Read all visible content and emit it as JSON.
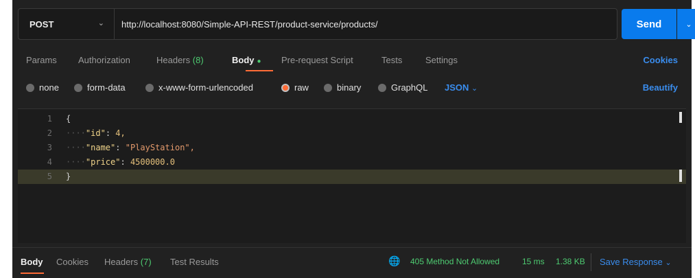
{
  "request": {
    "method": "POST",
    "url": "http://localhost:8080/Simple-API-REST/product-service/products/",
    "send_label": "Send"
  },
  "tabs": {
    "params": "Params",
    "authorization": "Authorization",
    "headers": "Headers",
    "headers_count": "(8)",
    "body": "Body",
    "pre_request": "Pre-request Script",
    "tests": "Tests",
    "settings": "Settings",
    "cookies": "Cookies"
  },
  "body_types": {
    "none": "none",
    "form_data": "form-data",
    "urlencoded": "x-www-form-urlencoded",
    "raw": "raw",
    "binary": "binary",
    "graphql": "GraphQL",
    "format": "JSON",
    "beautify": "Beautify",
    "selected": "raw"
  },
  "editor": {
    "lines": [
      {
        "n": "1",
        "text": "{"
      },
      {
        "n": "2",
        "key": "\"id\"",
        "value": "4,"
      },
      {
        "n": "3",
        "key": "\"name\"",
        "value": "\"PlayStation\","
      },
      {
        "n": "4",
        "key": "\"price\"",
        "value": "4500000.0"
      },
      {
        "n": "5",
        "text": "}"
      }
    ]
  },
  "response": {
    "tab_body": "Body",
    "tab_cookies": "Cookies",
    "tab_headers": "Headers",
    "headers_count": "(7)",
    "tab_test_results": "Test Results",
    "status": "405 Method Not Allowed",
    "time": "15 ms",
    "size": "1.38 KB",
    "save_response": "Save Response"
  },
  "colors": {
    "accent_blue": "#097bed",
    "accent_orange": "#ff6c37",
    "success_green": "#4ecb71"
  }
}
